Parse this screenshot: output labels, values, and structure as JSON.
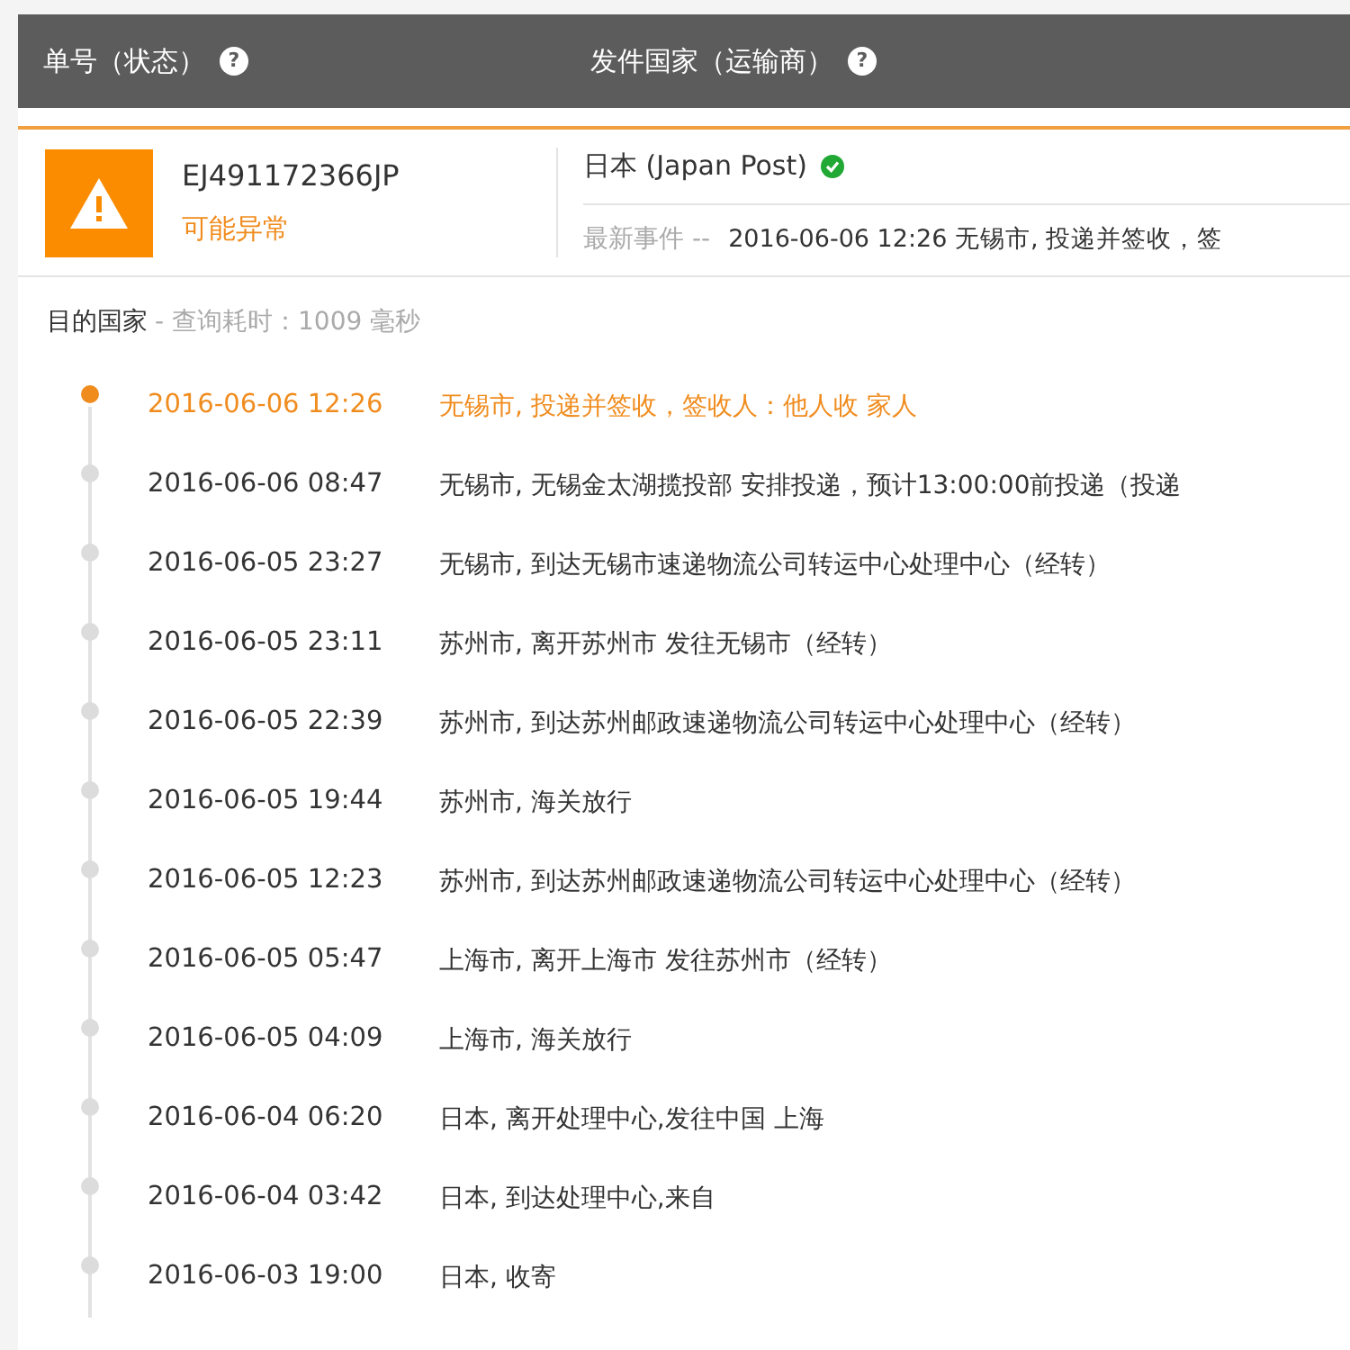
{
  "header": {
    "columns": [
      {
        "label": "单号（状态）",
        "help": "?"
      },
      {
        "label": "发件国家（运输商）",
        "help": "?"
      }
    ]
  },
  "shipment": {
    "number": "EJ491172366JP",
    "status": "可能异常",
    "origin": "日本 (Japan Post)",
    "origin_verified": true,
    "latest_label": "最新事件 --",
    "latest_event": "2016-06-06 12:26 无锡市, 投递并签收，签"
  },
  "destination": {
    "label": "目的国家",
    "query_time": "- 查询耗时：1009 毫秒"
  },
  "events": [
    {
      "time": "2016-06-06 12:26",
      "text": "无锡市, 投递并签收，签收人：他人收 家人",
      "current": true
    },
    {
      "time": "2016-06-06 08:47",
      "text": "无锡市, 无锡金太湖揽投部 安排投递，预计13:00:00前投递（投递",
      "current": false
    },
    {
      "time": "2016-06-05 23:27",
      "text": "无锡市, 到达无锡市速递物流公司转运中心处理中心（经转）",
      "current": false
    },
    {
      "time": "2016-06-05 23:11",
      "text": "苏州市, 离开苏州市 发往无锡市（经转）",
      "current": false
    },
    {
      "time": "2016-06-05 22:39",
      "text": "苏州市, 到达苏州邮政速递物流公司转运中心处理中心（经转）",
      "current": false
    },
    {
      "time": "2016-06-05 19:44",
      "text": "苏州市, 海关放行",
      "current": false
    },
    {
      "time": "2016-06-05 12:23",
      "text": "苏州市, 到达苏州邮政速递物流公司转运中心处理中心（经转）",
      "current": false
    },
    {
      "time": "2016-06-05 05:47",
      "text": "上海市, 离开上海市 发往苏州市（经转）",
      "current": false
    },
    {
      "time": "2016-06-05 04:09",
      "text": "上海市, 海关放行",
      "current": false
    },
    {
      "time": "2016-06-04 06:20",
      "text": "日本, 离开处理中心,发往中国 上海",
      "current": false
    },
    {
      "time": "2016-06-04 03:42",
      "text": "日本, 到达处理中心,来自",
      "current": false
    },
    {
      "time": "2016-06-03 19:00",
      "text": "日本, 收寄",
      "current": false
    }
  ]
}
